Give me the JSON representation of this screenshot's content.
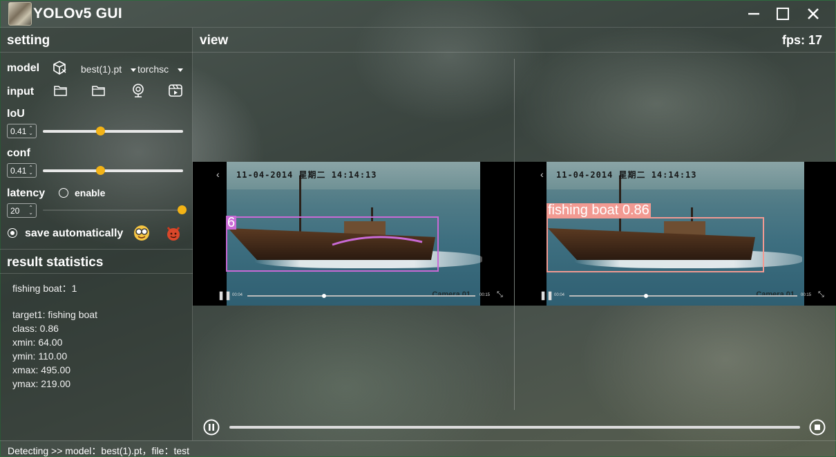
{
  "window": {
    "title": "YOLOv5 GUI",
    "controls": [
      "minimize-icon",
      "maximize-icon",
      "close-icon"
    ]
  },
  "setting": {
    "title": "setting",
    "model_label": "model",
    "model_file": "best(1).pt",
    "model_format": "torchsc",
    "input_label": "input",
    "iou_label": "IoU",
    "iou_value": "0.41",
    "iou_level": 0.38,
    "conf_label": "conf",
    "conf_value": "0.41",
    "conf_level": 0.38,
    "latency_label": "latency",
    "latency_enable": "enable",
    "latency_value": "20",
    "latency_level": 1.0,
    "save_label": "save automatically"
  },
  "result": {
    "title": "result statistics",
    "summary": "fishing boat：1",
    "target": "target1: fishing boat",
    "class": "class: 0.86",
    "xmin": "xmin: 64.00",
    "ymin": "ymin: 110.00",
    "xmax": "xmax: 495.00",
    "ymax": "ymax: 219.00"
  },
  "view": {
    "title": "view",
    "fps": "fps:  17"
  },
  "videos": {
    "timestamp": "11-04-2014  星期二  14:14:13",
    "camera": "Camera 01",
    "time_start": "00:04",
    "time_end": "00:15",
    "left_box_label": "6",
    "right_box_label": "fishing  boat  0.86",
    "left_box_color": "#c96ad6",
    "right_box_color": "#f29a92"
  },
  "playback": {
    "progress": 0
  },
  "status": {
    "text": "Detecting >> model：best(1).pt，file：test"
  },
  "colors": {
    "accent": "#f3b316",
    "frame_border": "#2e6a3e"
  }
}
